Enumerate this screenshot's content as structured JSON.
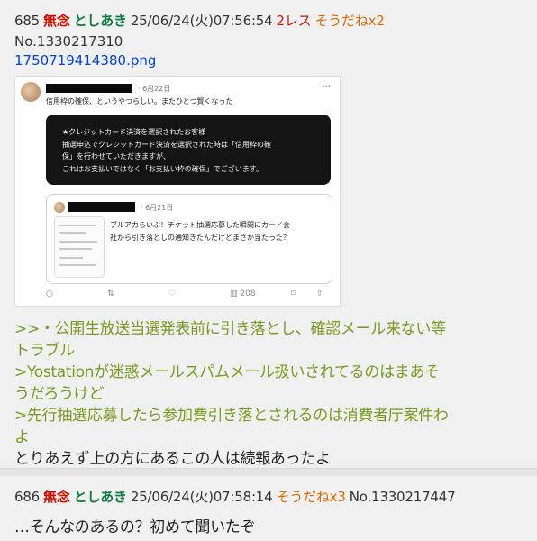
{
  "post1": {
    "num": "685",
    "mu": "無念",
    "name": "としあき",
    "date": "25/06/24(火)07:56:54",
    "res": "2レス",
    "soudane": "そうだねx2",
    "postno": "No.1330217310",
    "filename": "1750719414380.png",
    "tweet": {
      "date": "· 6月22日",
      "dots": "···",
      "text": "信用枠の確保、というやつらしい。またひとつ賢くなった",
      "box_lines": [
        "★クレジットカード決済を選択されたお客様",
        "抽選申込でクレジットカード決済を選択された時は「信用枠の確",
        "保」を行わせていただきますが、",
        "これはお支払いではなく「お支払い枠の確保」でございます。"
      ],
      "quote_date": "· 6月21日",
      "quote_lines": [
        "ブルアカらいぶ！チケット抽選応募した瞬間にカード会",
        "社から引き落としの通知きたんだけどまさか当たった？"
      ],
      "actions": [
        "○",
        "⇅",
        "♡",
        "▥ 208",
        "⌑",
        "⇧"
      ]
    },
    "comments": [
      {
        "text": ">>・公開生放送当選発表前に引き落とし、確認メール来ない等",
        "quote": true
      },
      {
        "text": "トラブル",
        "quote": true
      },
      {
        "text": ">Yostationが迷惑メールスパムメール扱いされてるのはまあそ",
        "quote": true
      },
      {
        "text": "うだろうけど",
        "quote": true
      },
      {
        "text": ">先行抽選応募したら参加費引き落とされるのは消費者庁案件わ",
        "quote": true
      },
      {
        "text": "よ",
        "quote": true
      },
      {
        "text": "とりあえず上の方にあるこの人は続報あったよ",
        "quote": false
      }
    ]
  },
  "post2": {
    "num": "686",
    "mu": "無念",
    "name": "としあき",
    "date": "25/06/24(火)07:58:14",
    "soudane": "そうだねx3",
    "postno": "No.1330217447",
    "comment": "…そんなのあるの？初めて聞いたぞ"
  },
  "colors": {
    "mu": "#cc1105",
    "name": "#117743",
    "soudane": "#d96a00",
    "quote": "#789922",
    "link": "#0044cc"
  }
}
